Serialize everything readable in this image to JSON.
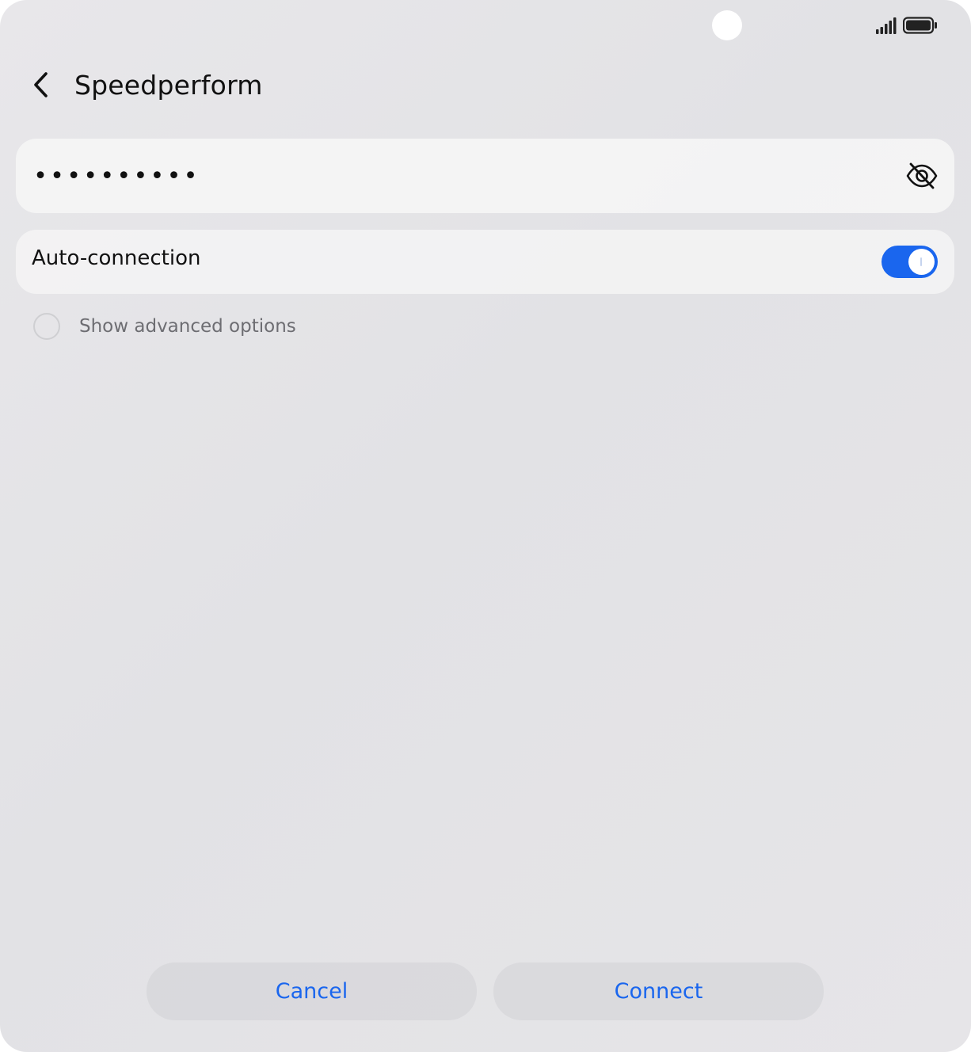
{
  "status_bar": {
    "signal_icon": "signal-bars-icon",
    "battery_icon": "battery-full-icon"
  },
  "header": {
    "back_icon": "chevron-left-icon",
    "title": "Speedperform"
  },
  "password": {
    "value": "••••••••••",
    "toggle_visibility_icon": "eye-off-icon"
  },
  "auto_connection": {
    "label": "Auto-connection",
    "enabled": true
  },
  "advanced_options": {
    "label": "Show advanced options",
    "checked": false
  },
  "actions": {
    "cancel_label": "Cancel",
    "connect_label": "Connect"
  },
  "colors": {
    "accent": "#1a66ee",
    "background": "#e5e5e8",
    "card": "#f3f3f3"
  }
}
